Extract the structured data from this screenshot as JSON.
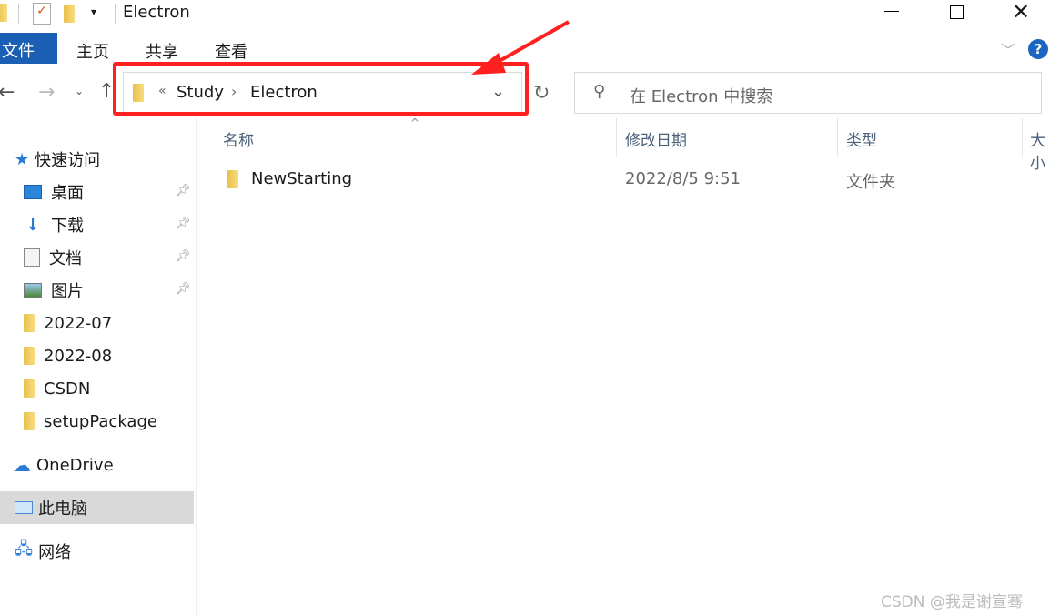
{
  "window": {
    "title": "Electron"
  },
  "ribbon": {
    "tabs": [
      "文件",
      "主页",
      "共享",
      "查看"
    ]
  },
  "address": {
    "path": [
      "Study",
      "Electron"
    ],
    "overflow": "«"
  },
  "search": {
    "placeholder": "在 Electron 中搜索"
  },
  "columns": [
    "名称",
    "修改日期",
    "类型",
    "大小"
  ],
  "files": [
    {
      "name": "NewStarting",
      "modified": "2022/8/5 9:51",
      "type": "文件夹"
    }
  ],
  "sidebar": {
    "quick_access": "快速访问",
    "items": [
      {
        "label": "桌面",
        "pinned": true
      },
      {
        "label": "下载",
        "pinned": true
      },
      {
        "label": "文档",
        "pinned": true
      },
      {
        "label": "图片",
        "pinned": true
      },
      {
        "label": "2022-07"
      },
      {
        "label": "2022-08"
      },
      {
        "label": "CSDN"
      },
      {
        "label": "setupPackage"
      }
    ],
    "onedrive": "OneDrive",
    "this_pc": "此电脑",
    "network": "网络"
  },
  "watermark": "CSDN @我是谢宣骞",
  "colors": {
    "accent": "#1a5fb4",
    "annotation": "#ff2020"
  }
}
